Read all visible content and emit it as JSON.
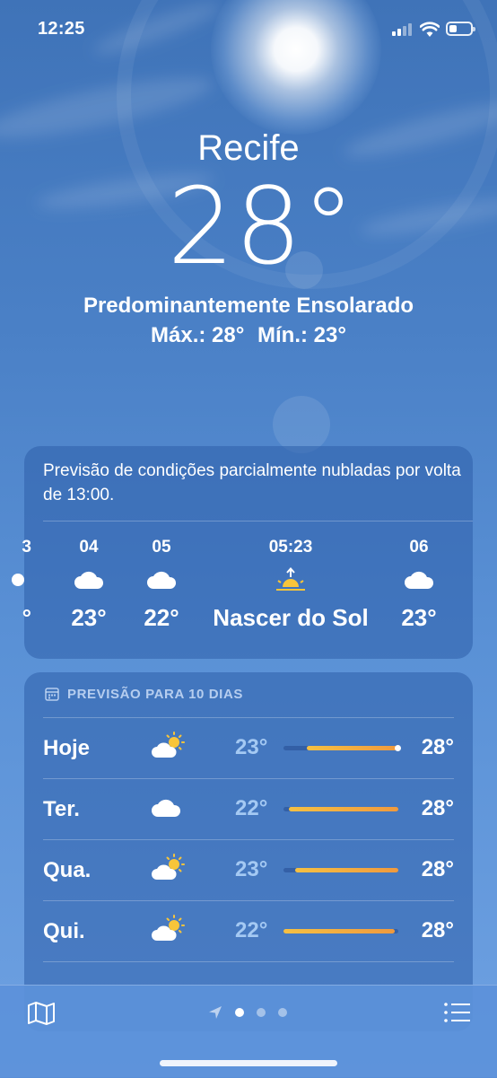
{
  "status_bar": {
    "time": "12:25"
  },
  "location": {
    "city": "Recife",
    "temperature": "28°",
    "condition": "Predominantemente Ensolarado",
    "high": "Máx.: 28°",
    "low": "Mín.: 23°"
  },
  "hourly": {
    "summary": "Previsão de condições parcialmente nubladas por volta de 13:00.",
    "items": [
      {
        "label": "3",
        "icon": "sun-icon",
        "temp": "°"
      },
      {
        "label": "04",
        "icon": "cloud-icon",
        "temp": "23°"
      },
      {
        "label": "05",
        "icon": "cloud-icon",
        "temp": "22°"
      },
      {
        "label": "05:23",
        "icon": "sunrise-icon",
        "temp": "Nascer do Sol"
      },
      {
        "label": "06",
        "icon": "cloud-icon",
        "temp": "23°"
      }
    ]
  },
  "daily": {
    "header": "PREVISÃO PARA 10 DIAS",
    "days": [
      {
        "name": "Hoje",
        "icon": "partly-sunny-icon",
        "low": "23°",
        "high": "28°",
        "range_start": 0.2,
        "range_end": 1.0,
        "current": 1.0
      },
      {
        "name": "Ter.",
        "icon": "cloud-icon",
        "low": "22°",
        "high": "28°",
        "range_start": 0.05,
        "range_end": 1.0
      },
      {
        "name": "Qua.",
        "icon": "partly-sunny-icon",
        "low": "23°",
        "high": "28°",
        "range_start": 0.1,
        "range_end": 1.0
      },
      {
        "name": "Qui.",
        "icon": "partly-sunny-icon",
        "low": "22°",
        "high": "28°",
        "range_start": 0.0,
        "range_end": 0.97
      }
    ]
  },
  "colors": {
    "bar_start": "#f5c043",
    "bar_end": "#f09a3e",
    "sun": "#f8c53a"
  }
}
